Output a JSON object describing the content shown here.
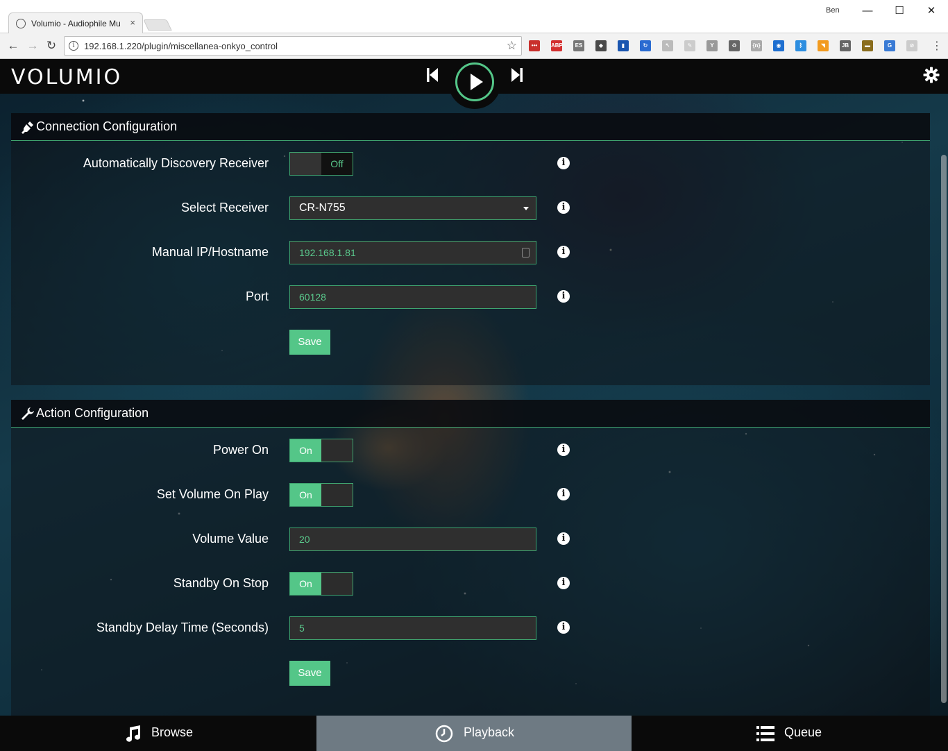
{
  "browser": {
    "tab_title": "Volumio - Audiophile Mu",
    "tab_close": "×",
    "profile_name": "Ben",
    "url": "192.168.1.220/plugin/miscellanea-onkyo_control",
    "window_minimize": "—",
    "window_maximize": "☐",
    "window_close": "✕",
    "extensions": [
      {
        "name": "lastpass-icon",
        "color": "#c9302c",
        "glyph": "•••"
      },
      {
        "name": "adblock-icon",
        "color": "#d32f2f",
        "glyph": "ABP"
      },
      {
        "name": "es-icon",
        "color": "#777777",
        "glyph": "ES"
      },
      {
        "name": "evernote-icon",
        "color": "#4a4a4a",
        "glyph": "◆"
      },
      {
        "name": "bookmark-icon",
        "color": "#1a56b0",
        "glyph": "▮"
      },
      {
        "name": "hand-icon",
        "color": "#2a6bd1",
        "glyph": "↻"
      },
      {
        "name": "cursor-icon",
        "color": "#bbbbbb",
        "glyph": "↖"
      },
      {
        "name": "note-icon",
        "color": "#cccccc",
        "glyph": "✎"
      },
      {
        "name": "antenna-icon",
        "color": "#999999",
        "glyph": "Y"
      },
      {
        "name": "recycle-icon",
        "color": "#666666",
        "glyph": "♻"
      },
      {
        "name": "json-icon",
        "color": "#aaaaaa",
        "glyph": "{n}"
      },
      {
        "name": "globe-icon",
        "color": "#1e6fd0",
        "glyph": "◉"
      },
      {
        "name": "bluetooth-icon",
        "color": "#2d8ee0",
        "glyph": "ᛒ"
      },
      {
        "name": "rss-icon",
        "color": "#f29a1e",
        "glyph": "◥"
      },
      {
        "name": "jb-icon",
        "color": "#666666",
        "glyph": "JB"
      },
      {
        "name": "burger-icon",
        "color": "#8a6d1d",
        "glyph": "▬"
      },
      {
        "name": "translate-icon",
        "color": "#3a7bd5",
        "glyph": "G"
      },
      {
        "name": "blocked-icon",
        "color": "#cccccc",
        "glyph": "⊘"
      }
    ]
  },
  "app": {
    "logo": "VOLUMIO",
    "colors": {
      "accent": "#54c688",
      "topbar": "#0a0a0a",
      "active_tab": "#6e7a83"
    }
  },
  "connection": {
    "title": "Connection Configuration",
    "auto_discovery": {
      "label": "Automatically Discovery Receiver",
      "state": "Off"
    },
    "select_receiver": {
      "label": "Select Receiver",
      "value": "CR-N755"
    },
    "manual_ip": {
      "label": "Manual IP/Hostname",
      "value": "192.168.1.81"
    },
    "port": {
      "label": "Port",
      "value": "60128"
    },
    "save_label": "Save"
  },
  "action": {
    "title": "Action Configuration",
    "power_on": {
      "label": "Power On",
      "state": "On"
    },
    "set_volume_on_play": {
      "label": "Set Volume On Play",
      "state": "On"
    },
    "volume_value": {
      "label": "Volume Value",
      "value": "20"
    },
    "standby_on_stop": {
      "label": "Standby On Stop",
      "state": "On"
    },
    "standby_delay": {
      "label": "Standby Delay Time (Seconds)",
      "value": "5"
    },
    "save_label": "Save"
  },
  "info_glyph": "i",
  "bottom_nav": {
    "browse": "Browse",
    "playback": "Playback",
    "queue": "Queue",
    "active": "Playback"
  }
}
